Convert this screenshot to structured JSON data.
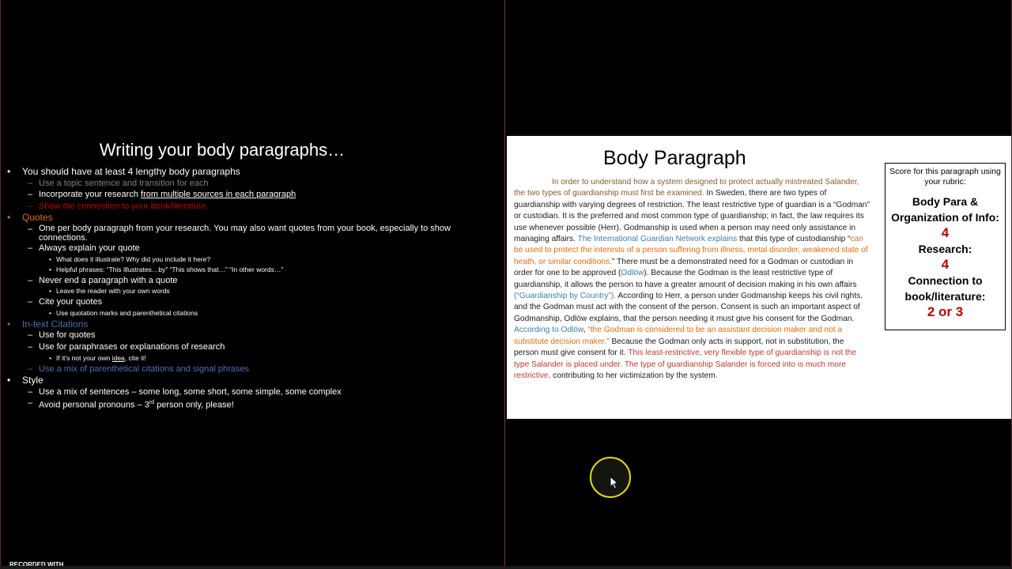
{
  "left_slide": {
    "title": "Writing your body paragraphs…",
    "items": [
      {
        "text": "You should have at least 4 lengthy body paragraphs"
      },
      {
        "text": "Use a topic sentence and transition for each"
      },
      {
        "pre": "Incorporate your research ",
        "link": "from multiple sources in each paragraph"
      },
      {
        "text": "Show the connection to your book/literature."
      },
      {
        "text": "Quotes"
      },
      {
        "text": "One per body paragraph from your research.  You may also want quotes from your book, especially to show connections."
      },
      {
        "text": "Always explain your quote"
      },
      {
        "text": "What does it illustrate?  Why did you include it here?"
      },
      {
        "text": "Helpful phrases:  “This illustrates…by” “This shows  that…” “In other words…”"
      },
      {
        "text": "Never end a paragraph with a quote"
      },
      {
        "text": "Leave the reader with your own words"
      },
      {
        "text": "Cite your quotes"
      },
      {
        "text": "Use quotation marks and parenthetical citations"
      },
      {
        "text": "In-text Citations"
      },
      {
        "text": "Use for quotes"
      },
      {
        "text": "Use for paraphrases or explanations of research"
      },
      {
        "pre": "If it’s not your own ",
        "link": "idea",
        "post": ", cite it!"
      },
      {
        "text": "Use a mix of parenthetical citations and signal phrases"
      },
      {
        "text": "Style"
      },
      {
        "text": "Use a mix of sentences – some long, some short, some simple, some complex"
      },
      {
        "pre": "Avoid personal pronouns – 3",
        "sup": "rd",
        "post": " person only, please!"
      }
    ]
  },
  "right_doc": {
    "title": "Body Paragraph",
    "segments": [
      "In order to understand how a system designed to protect actually mistreated Salander, the two types of guardianship must first be examined.",
      "  In Sweden, there are two types of guardianship with varying degrees of restriction.  The least restrictive type of guardian is a “Godman” or custodian.  It is the preferred and most common type of guardianship; in fact, the law requires its use whenever possible (Herr).  Godmanship is used when a person may need only assistance in managing affairs.  ",
      "The International Guardian Network explains",
      " that this type of custodianship “",
      "can be used to protect the interests of a person suffering from illness, metal disorder, weakened state of heath, or similar conditions.",
      "”  There must be a demonstrated need for a Godman or custodian in order for one to be approved (",
      "Odlöw",
      ").  Because the Godman is the least restrictive type of guardianship, it allows the person to have a greater amount of decision making in his own affairs ",
      "(“Guardianship by Country”).",
      "  According to Herr, a person under Godmanship keeps his civil rights, and the Godman must act with the consent of the person.  Consent is such an important aspect of Godmanship, Odlöw explains, that the person needing it must give his consent for the Godman.  ",
      "According to Odlöw",
      ", ",
      "“the Godman is considered to be an assistant decision maker and not a substitute decision maker.”",
      "  Because the Godman only acts in support, not in substitution, the person must give consent for it.  ",
      "This least-restrictive, very flexible type of guardianship is not the type Salander is placed under.  The type of guardianship Salander is forced into is much more restrictive,",
      " contributing to her victimization by the system."
    ],
    "score_box": {
      "intro": "Score for this paragraph using your rubric:",
      "label1": "Body Para & Organization of Info:",
      "value1": "4",
      "label2": "Research:",
      "value2": "4",
      "label3": "Connection to book/literature:",
      "value3": "2 or 3"
    }
  },
  "watermark": "RECORDED WITH",
  "colors": {
    "gray": "#7f7f7f",
    "orange": "#e26b0a",
    "red": "#c00000",
    "blue": "#4f6fb5",
    "cursor_ring": "#e8e000"
  }
}
